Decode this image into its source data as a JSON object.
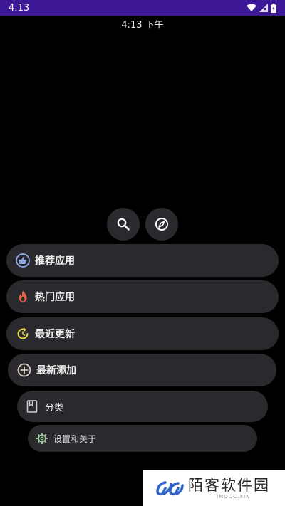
{
  "status_bar": {
    "time": "4:13",
    "bg_color": "#3c1796",
    "icons": [
      "wifi-icon",
      "signal-icon",
      "battery-icon"
    ]
  },
  "clock": {
    "text": "4:13 下午"
  },
  "quick_actions": [
    {
      "name": "search",
      "icon": "search-icon"
    },
    {
      "name": "compass",
      "icon": "compass-icon"
    }
  ],
  "menu": {
    "recommended": {
      "label": "推荐应用",
      "icon": "thumbs-up-icon",
      "color": "#8aa6e6"
    },
    "popular": {
      "label": "热门应用",
      "icon": "flame-icon",
      "color": "#e4624a"
    },
    "recent_updates": {
      "label": "最近更新",
      "icon": "refresh-icon",
      "color": "#e8d84a"
    },
    "recently_added": {
      "label": "最新添加",
      "icon": "add-circle-icon",
      "color": "#e0d2c4"
    },
    "categories": {
      "label": "分类",
      "icon": "book-icon",
      "color": "#cccccc"
    },
    "settings": {
      "label": "设置和关于",
      "icon": "gear-icon",
      "color": "#9cc49a"
    }
  },
  "watermark": {
    "title": "陌客软件园",
    "subtitle": "IMOOC.XIN",
    "accent": "#2f63c9"
  }
}
